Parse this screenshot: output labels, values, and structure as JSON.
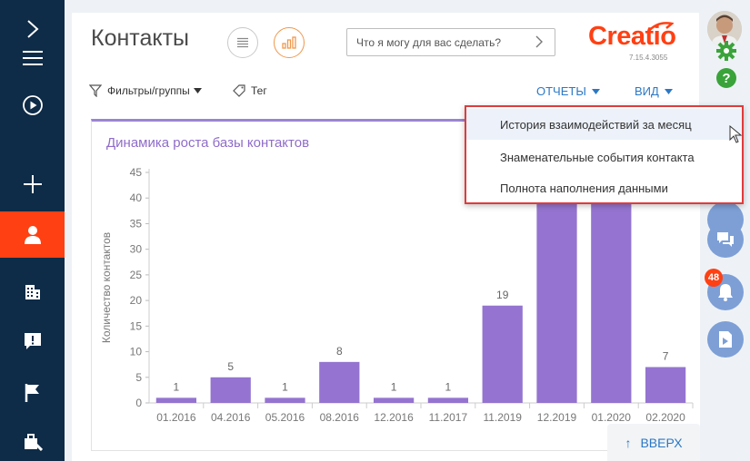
{
  "header": {
    "title": "Контакты",
    "search_placeholder": "Что я могу для вас сделать?",
    "logo": "Creatio",
    "version": "7.15.4.3055"
  },
  "toolbar": {
    "filters_label": "Фильтры/группы",
    "tag_label": "Тег",
    "reports_label": "ОТЧЕТЫ",
    "view_label": "ВИД"
  },
  "sidebar": {
    "items": [
      "expand-icon",
      "menu-icon",
      "play-icon",
      "add-icon",
      "contact-icon",
      "accounts-icon",
      "notification-icon",
      "flag-icon",
      "tools-icon"
    ],
    "active_color": "#ff4013"
  },
  "rail": {
    "notification_count": "48"
  },
  "reports_menu": {
    "items": [
      "История взаимодействий за месяц",
      "Знаменательные события контакта",
      "Полнота наполнения данными"
    ]
  },
  "chart_data": {
    "type": "bar",
    "title": "Динамика роста базы контактов",
    "ylabel": "Количество контактов",
    "categories": [
      "01.2016",
      "04.2016",
      "05.2016",
      "08.2016",
      "12.2016",
      "11.2017",
      "11.2019",
      "12.2019",
      "01.2020",
      "02.2020"
    ],
    "values": [
      1,
      5,
      1,
      8,
      1,
      1,
      19,
      40,
      40,
      7
    ],
    "labels": [
      "1",
      "5",
      "1",
      "8",
      "1",
      "1",
      "19",
      "",
      "",
      "7"
    ],
    "yticks": [
      "0",
      "5",
      "10",
      "15",
      "20",
      "25",
      "30",
      "35",
      "40",
      "45"
    ],
    "ylim": [
      0,
      45
    ],
    "color": "#9474d0"
  },
  "scroll_up": {
    "arrow": "↑",
    "label": "ВВЕРХ"
  }
}
